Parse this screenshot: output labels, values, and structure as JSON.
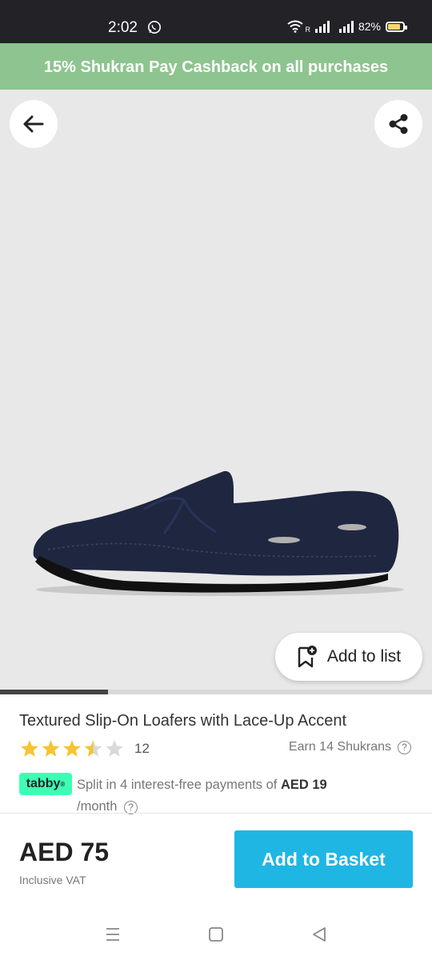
{
  "status_bar": {
    "time": "2:02",
    "battery": "82%",
    "battery_level": 0.82
  },
  "promo": {
    "text": "15% Shukran Pay Cashback on all purchases"
  },
  "gallery": {
    "add_to_list_label": "Add to list",
    "progress": 0.25
  },
  "product": {
    "title": "Textured Slip-On Loafers with Lace-Up Accent",
    "rating": 3.5,
    "rating_count": "12",
    "shukrans": "Earn 14 Shukrans"
  },
  "tabby": {
    "badge": "tabby",
    "text_before": "Split in 4 interest-free payments of ",
    "amount": "AED 19",
    "text_after": "/month"
  },
  "purchase": {
    "price": "AED 75",
    "vat_note": "Inclusive VAT",
    "button_label": "Add to Basket"
  },
  "colors": {
    "promo_bg": "#8ec48f",
    "basket_button": "#1fb6e4",
    "star": "#f6c431",
    "tabby_badge": "#3cffb4"
  }
}
